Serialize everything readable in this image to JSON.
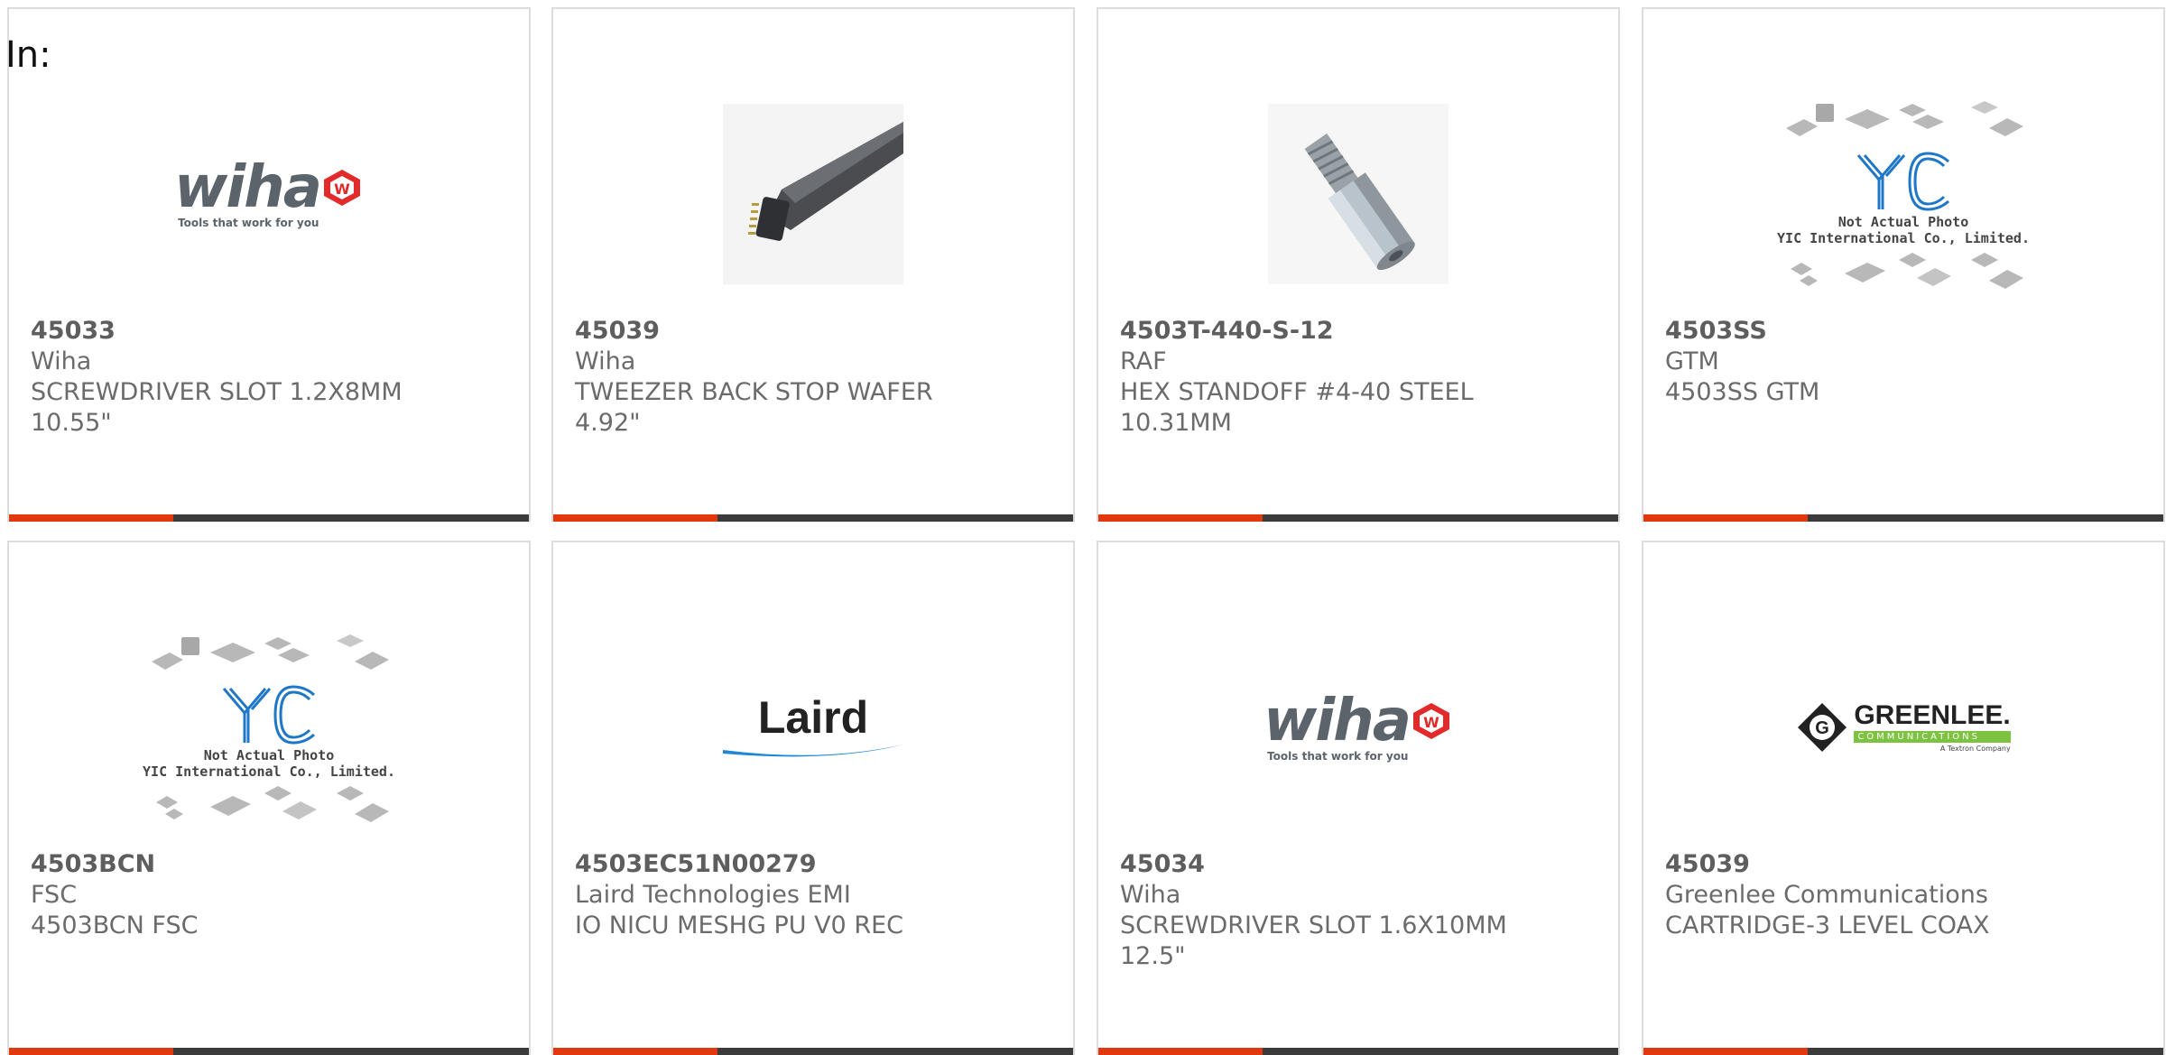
{
  "header": {
    "in_label": "In:"
  },
  "colors": {
    "accent": "#e2380f",
    "bar": "#3b3b3b",
    "text": "#6b6b6b",
    "border": "#dcdcdc"
  },
  "cards": [
    {
      "part_number": "45033",
      "manufacturer": "Wiha",
      "description": "SCREWDRIVER SLOT 1.2X8MM",
      "length": "10.55\"",
      "image": "wiha-logo",
      "logo": {
        "word": "wiha",
        "tagline": "Tools that work for you"
      }
    },
    {
      "part_number": "45039",
      "manufacturer": "Wiha",
      "description": "TWEEZER BACK STOP WAFER",
      "length": "4.92\"",
      "image": "tweezer-photo"
    },
    {
      "part_number": "4503T-440-S-12",
      "manufacturer": "RAF",
      "description": "HEX STANDOFF #4-40 STEEL",
      "length": "10.31MM",
      "image": "hex-standoff-photo"
    },
    {
      "part_number": "4503SS",
      "manufacturer": "GTM",
      "description": "4503SS GTM",
      "length": "",
      "image": "yic-placeholder",
      "logo": {
        "note_1": "Not Actual Photo",
        "note_2": "YIC International Co., Limited."
      }
    },
    {
      "part_number": "4503BCN",
      "manufacturer": "FSC",
      "description": "4503BCN FSC",
      "length": "",
      "image": "yic-placeholder",
      "logo": {
        "note_1": "Not Actual Photo",
        "note_2": "YIC International Co., Limited."
      }
    },
    {
      "part_number": "4503EC51N00279",
      "manufacturer": "Laird Technologies EMI",
      "description": "IO NICU MESHG PU V0 REC",
      "length": "",
      "image": "laird-logo",
      "logo": {
        "word": "Laird"
      }
    },
    {
      "part_number": "45034",
      "manufacturer": "Wiha",
      "description": "SCREWDRIVER SLOT 1.6X10MM",
      "length": "12.5\"",
      "image": "wiha-logo",
      "logo": {
        "word": "wiha",
        "tagline": "Tools that work for you"
      }
    },
    {
      "part_number": "45039",
      "manufacturer": "Greenlee Communications",
      "description": "CARTRIDGE-3 LEVEL COAX",
      "length": "",
      "image": "greenlee-logo",
      "logo": {
        "word": "GREENLEE.",
        "sub": "COMMUNICATIONS",
        "tag": "A Textron Company"
      }
    }
  ]
}
